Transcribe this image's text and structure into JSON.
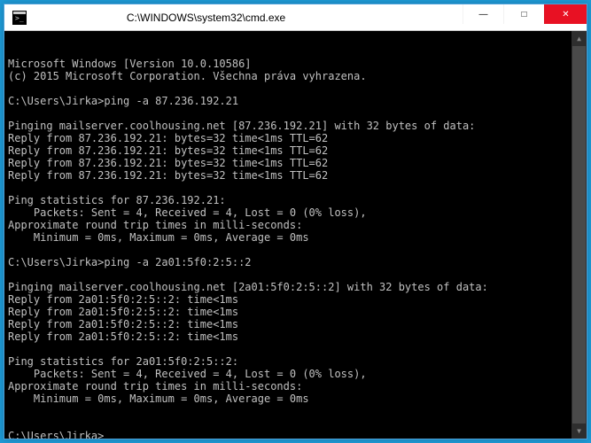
{
  "titlebar": {
    "title": "C:\\WINDOWS\\system32\\cmd.exe",
    "minimize_icon": "—",
    "maximize_icon": "□",
    "close_icon": "✕"
  },
  "terminal": {
    "lines": [
      "Microsoft Windows [Version 10.0.10586]",
      "(c) 2015 Microsoft Corporation. Všechna práva vyhrazena.",
      "",
      "C:\\Users\\Jirka>ping -a 87.236.192.21",
      "",
      "Pinging mailserver.coolhousing.net [87.236.192.21] with 32 bytes of data:",
      "Reply from 87.236.192.21: bytes=32 time<1ms TTL=62",
      "Reply from 87.236.192.21: bytes=32 time<1ms TTL=62",
      "Reply from 87.236.192.21: bytes=32 time<1ms TTL=62",
      "Reply from 87.236.192.21: bytes=32 time<1ms TTL=62",
      "",
      "Ping statistics for 87.236.192.21:",
      "    Packets: Sent = 4, Received = 4, Lost = 0 (0% loss),",
      "Approximate round trip times in milli-seconds:",
      "    Minimum = 0ms, Maximum = 0ms, Average = 0ms",
      "",
      "C:\\Users\\Jirka>ping -a 2a01:5f0:2:5::2",
      "",
      "Pinging mailserver.coolhousing.net [2a01:5f0:2:5::2] with 32 bytes of data:",
      "Reply from 2a01:5f0:2:5::2: time<1ms",
      "Reply from 2a01:5f0:2:5::2: time<1ms",
      "Reply from 2a01:5f0:2:5::2: time<1ms",
      "Reply from 2a01:5f0:2:5::2: time<1ms",
      "",
      "Ping statistics for 2a01:5f0:2:5::2:",
      "    Packets: Sent = 4, Received = 4, Lost = 0 (0% loss),",
      "Approximate round trip times in milli-seconds:",
      "    Minimum = 0ms, Maximum = 0ms, Average = 0ms",
      "",
      ""
    ],
    "prompt": "C:\\Users\\Jirka>"
  }
}
